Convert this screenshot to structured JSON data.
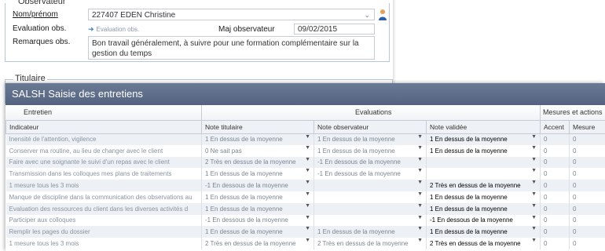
{
  "observateur": {
    "legend": "Observateur",
    "nom_label": "Nom/prénom",
    "nom_value": "227407 EDEN Christine",
    "evaluation_label": "Evaluation obs.",
    "evaluation_link": "Evaluation obs.",
    "maj_label": "Maj observateur",
    "maj_value": "09/02/2015",
    "remarques_label": "Remarques obs.",
    "remarques_value": "Bon travail généralement, à suivre pour une formation complémentaire sur la gestion du temps"
  },
  "titulaire": {
    "legend": "Titulaire"
  },
  "panel": {
    "title": "SALSH Saisie des entretiens",
    "groups": {
      "entretien": "Entretien",
      "evaluations": "Evaluations",
      "mesures": "Mesures et actions"
    },
    "columns": {
      "indicateur": "Indicateur",
      "note_titulaire": "Note titulaire",
      "note_observateur": "Note observateur",
      "note_validee": "Note validée",
      "accent": "Accent",
      "mesure": "Mesure"
    },
    "rows": [
      {
        "indicateur": "Inensité de l'attention, vigilence",
        "titulaire": "1 En dessus de la moyenne",
        "observateur": "1 En dessus de la moyenne",
        "validee": "1 En dessus de la moyenne",
        "accent": "0",
        "mesure": "0"
      },
      {
        "indicateur": "Conserver ma routine, au lieu de changer avec le client",
        "titulaire": "0 Ne sait pas",
        "observateur": "1 En dessus de la moyenne",
        "validee": "1 En dessus de la moyenne",
        "accent": "0",
        "mesure": "0"
      },
      {
        "indicateur": "Faire avec une soignante le suivi d'un repas avec le client",
        "titulaire": "2 Très en dessus de la moyenne",
        "observateur": "-1 En dessous de la moyenne",
        "validee": "",
        "accent": "0",
        "mesure": "0"
      },
      {
        "indicateur": "Transmission dans les colloques mes plans de traitements",
        "titulaire": "1 En dessus de la moyenne",
        "observateur": "-1 En dessous de la moyenne",
        "validee": "",
        "accent": "0",
        "mesure": "0"
      },
      {
        "indicateur": "1 mesure tous les 3 mois",
        "titulaire": "-1 En dessous de la moyenne",
        "observateur": "",
        "validee": "2 Très en dessus de la moyenne",
        "accent": "0",
        "mesure": "0"
      },
      {
        "indicateur": "Manque de discipline dans la communication des observations au",
        "titulaire": "1 En dessus de la moyenne",
        "observateur": "",
        "validee": "1 En dessus de la moyenne",
        "accent": "0",
        "mesure": "0"
      },
      {
        "indicateur": "Evaluation des ressources du client dans les diverses activités d",
        "titulaire": "1 En dessus de la moyenne",
        "observateur": "",
        "validee": "1 En dessus de la moyenne",
        "accent": "0",
        "mesure": "0"
      },
      {
        "indicateur": "Participer aux colloques",
        "titulaire": "-1 En dessous de la moyenne",
        "observateur": "",
        "validee": "-1 En dessous de la moyenne",
        "accent": "0",
        "mesure": "0"
      },
      {
        "indicateur": "Remplir les pages du dossier",
        "titulaire": "1 En dessus de la moyenne",
        "observateur": "1 En dessus de la moyenne",
        "validee": "1 En dessus de la moyenne",
        "accent": "0",
        "mesure": "0"
      },
      {
        "indicateur": "1 mesure tous les 3 mois",
        "titulaire": "2 Très en dessus de la moyenne",
        "observateur": "2 Très en dessus de la moyenne",
        "validee": "2 Très en dessus de la moyenne",
        "accent": "0",
        "mesure": "0"
      }
    ]
  }
}
